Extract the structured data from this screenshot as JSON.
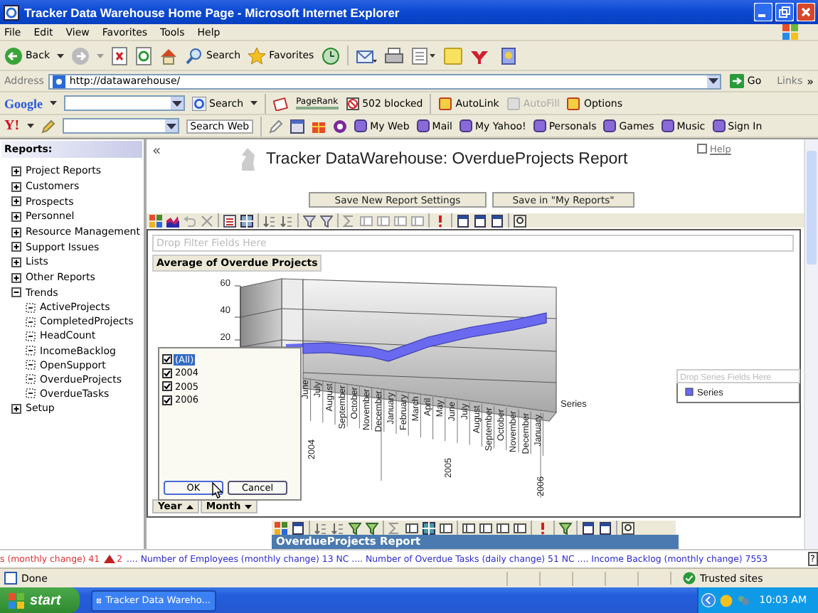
{
  "window": {
    "title": "Tracker Data Warehouse Home Page - Microsoft Internet Explorer"
  },
  "menu": [
    "File",
    "Edit",
    "View",
    "Favorites",
    "Tools",
    "Help"
  ],
  "toolbar": {
    "back": "Back",
    "search": "Search",
    "favorites": "Favorites"
  },
  "address": {
    "label": "Address",
    "value": "http://datawarehouse/",
    "go": "Go",
    "links": "Links",
    "more": "»"
  },
  "google_bar": {
    "logo": "Google",
    "search": "Search",
    "pagerank": "PageRank",
    "blocked": "502 blocked",
    "items": [
      {
        "label": "AutoLink",
        "disabled": false
      },
      {
        "label": "AutoFill",
        "disabled": true
      },
      {
        "label": "Options",
        "disabled": false
      }
    ]
  },
  "yahoo_bar": {
    "logo": "Y!",
    "search": "Search Web",
    "items": [
      "My Web",
      "Mail",
      "My Yahoo!",
      "Personals",
      "Games",
      "Music",
      "Sign In"
    ]
  },
  "sidebar": {
    "title": "Reports:",
    "items": [
      {
        "label": "Project Reports",
        "expanded": false
      },
      {
        "label": "Customers",
        "expanded": false
      },
      {
        "label": "Prospects",
        "expanded": false
      },
      {
        "label": "Personnel",
        "expanded": false
      },
      {
        "label": "Resource Management",
        "expanded": false
      },
      {
        "label": "Support Issues",
        "expanded": false
      },
      {
        "label": "Lists",
        "expanded": false
      },
      {
        "label": "Other Reports",
        "expanded": false
      },
      {
        "label": "Trends",
        "expanded": true,
        "children": [
          {
            "label": "ActiveProjects"
          },
          {
            "label": "CompletedProjects"
          },
          {
            "label": "HeadCount"
          },
          {
            "label": "IncomeBacklog"
          },
          {
            "label": "OpenSupport"
          },
          {
            "label": "OverdueProjects"
          },
          {
            "label": "OverdueTasks"
          }
        ]
      },
      {
        "label": "Setup",
        "expanded": false
      }
    ]
  },
  "report": {
    "collapse": "«",
    "title": "Tracker DataWarehouse: OverdueProjects Report",
    "help": "Help",
    "buttons": [
      "Save New Report Settings",
      "Save in \"My Reports\""
    ],
    "filter_placeholder": "Drop Filter Fields Here",
    "chart_title": "Average of Overdue Projects",
    "y_labels": [
      "60",
      "40",
      "20"
    ],
    "months": [
      "June",
      "July",
      "August",
      "September",
      "October",
      "November",
      "December",
      "January",
      "February",
      "March",
      "April",
      "May",
      "June",
      "July",
      "August",
      "September",
      "October",
      "November",
      "December",
      "January"
    ],
    "years": [
      "2004",
      "2005",
      "2006"
    ],
    "series_axis": "Series",
    "legend": {
      "placeholder": "Drop Series Fields Here",
      "items": [
        {
          "label": "Series",
          "color": "#6a6af0"
        }
      ]
    },
    "filter_list": {
      "items": [
        {
          "label": "(All)",
          "checked": true,
          "selected": true
        },
        {
          "label": "2004",
          "checked": true,
          "selected": false
        },
        {
          "label": "2005",
          "checked": true,
          "selected": false
        },
        {
          "label": "2006",
          "checked": true,
          "selected": false
        }
      ],
      "buttons": [
        "OK",
        "Cancel"
      ]
    },
    "fields": [
      "Year",
      "Month"
    ],
    "caption": "OverdueProjects Report"
  },
  "ticker": {
    "segments": [
      {
        "kind": "text",
        "text": "s (monthly change) 41",
        "color": "#e03030"
      },
      {
        "kind": "up",
        "text": "2",
        "color": "#e03030"
      },
      {
        "kind": "text",
        "text": ".... Number of Employees (monthly change) 13 NC .... Number of Overdue Tasks (daily change) 51 NC .... Income Backlog (monthly change) 7553",
        "color": "#2a2ad0"
      }
    ],
    "help": "?"
  },
  "status_bar": {
    "text": "Done",
    "zone": "Trusted sites"
  },
  "taskbar": {
    "start": "start",
    "task": "Tracker Data Wareho...",
    "time": "10:03 AM"
  }
}
